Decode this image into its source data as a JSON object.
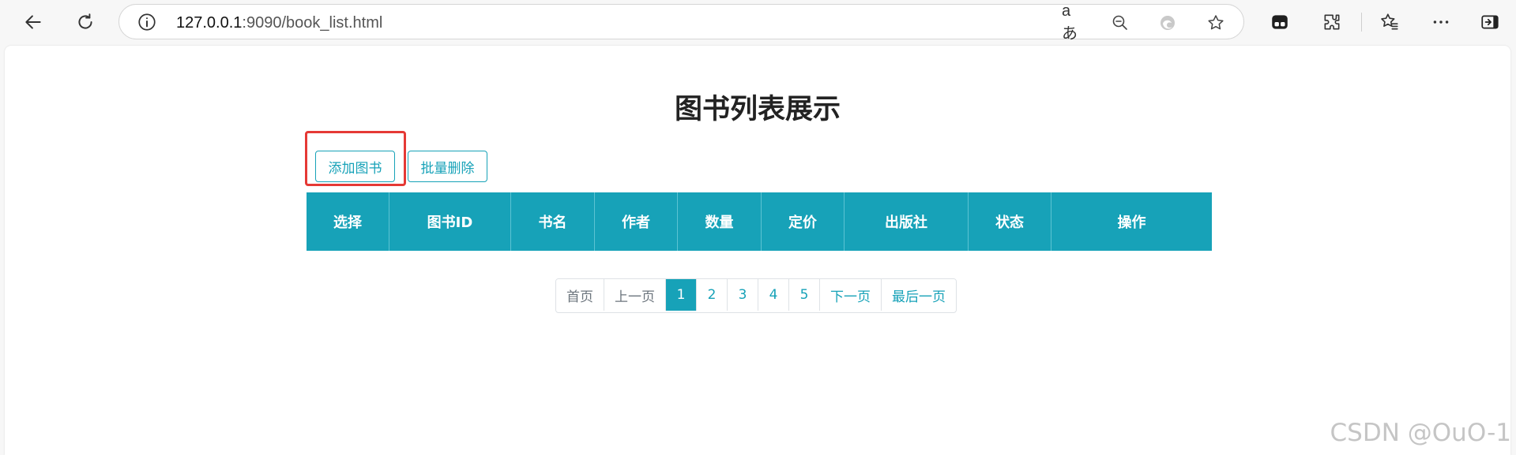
{
  "browser": {
    "url_host": "127.0.0.1",
    "url_rest": ":9090/book_list.html",
    "read_aloud_label": "aあ",
    "icons": [
      "back-icon",
      "refresh-icon",
      "info-icon",
      "read-aloud-icon",
      "zoom-out-icon",
      "edge-icon",
      "favorite-star-icon",
      "tab-action-icon",
      "extensions-icon",
      "favorites-icon",
      "more-icon",
      "sidebar-icon"
    ]
  },
  "page": {
    "title": "图书列表展示",
    "add_button": "添加图书",
    "batch_delete_button": "批量删除",
    "highlight_color": "#e53935",
    "accent_color": "#17a2b8"
  },
  "table": {
    "headers": [
      "选择",
      "图书ID",
      "书名",
      "作者",
      "数量",
      "定价",
      "出版社",
      "状态",
      "操作"
    ]
  },
  "pagination": {
    "first": "首页",
    "prev": "上一页",
    "pages": [
      "1",
      "2",
      "3",
      "4",
      "5"
    ],
    "active_page": "1",
    "next": "下一页",
    "last": "最后一页"
  },
  "watermark": "CSDN @OuO-1"
}
